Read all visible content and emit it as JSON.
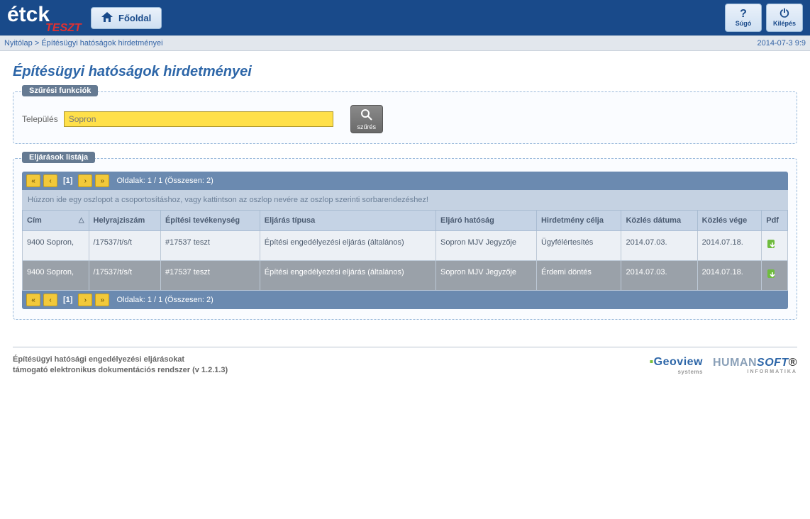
{
  "header": {
    "home_label": "Főoldal",
    "help_label": "Súgó",
    "logout_label": "Kilépés",
    "logo_test": "TESZT"
  },
  "breadcrumb": {
    "root": "Nyitólap",
    "sep": ">",
    "current": "Építésügyi hatóságok hirdetményei",
    "datetime": "2014-07-3 9:9"
  },
  "page": {
    "title": "Építésügyi hatóságok hirdetményei"
  },
  "filter": {
    "legend": "Szűrési funkciók",
    "label": "Település",
    "value": "Sopron",
    "button": "szűrés"
  },
  "list": {
    "legend": "Eljárások listája",
    "pager": {
      "current": "[1]",
      "info": "Oldalak: 1 / 1 (Összesen: 2)"
    },
    "group_hint": "Húzzon ide egy oszlopot a csoportosításhoz, vagy kattintson az oszlop nevére az oszlop szerinti sorbarendezéshez!",
    "columns": {
      "cim": "Cím",
      "helyrajz": "Helyrajziszám",
      "tevekenyseg": "Építési tevékenység",
      "tipus": "Eljárás típusa",
      "hatosag": "Eljáró hatóság",
      "cel": "Hirdetmény célja",
      "kozles_datuma": "Közlés dátuma",
      "kozles_vege": "Közlés vége",
      "pdf": "Pdf",
      "sort_asc": "△"
    },
    "rows": [
      {
        "cim": "9400 Sopron,",
        "helyrajz": "/17537/t/s/t",
        "tevekenyseg": "#17537 teszt",
        "tipus": "Építési engedélyezési eljárás (általános)",
        "hatosag": "Sopron MJV Jegyzője",
        "cel": "Ügyfélértesítés",
        "kozles_datuma": "2014.07.03.",
        "kozles_vege": "2014.07.18."
      },
      {
        "cim": "9400 Sopron,",
        "helyrajz": "/17537/t/s/t",
        "tevekenyseg": "#17537 teszt",
        "tipus": "Építési engedélyezési eljárás (általános)",
        "hatosag": "Sopron MJV Jegyzője",
        "cel": "Érdemi döntés",
        "kozles_datuma": "2014.07.03.",
        "kozles_vege": "2014.07.18."
      }
    ]
  },
  "footer": {
    "line1": "Építésügyi hatósági engedélyezési eljárásokat",
    "line2": "támogató elektronikus dokumentációs rendszer (v 1.2.1.3)",
    "logo1": "Geoview",
    "logo1_sub": "systems",
    "logo2_a": "HUMAN",
    "logo2_b": "SOFT",
    "logo2_sub": "INFORMATIKA"
  }
}
